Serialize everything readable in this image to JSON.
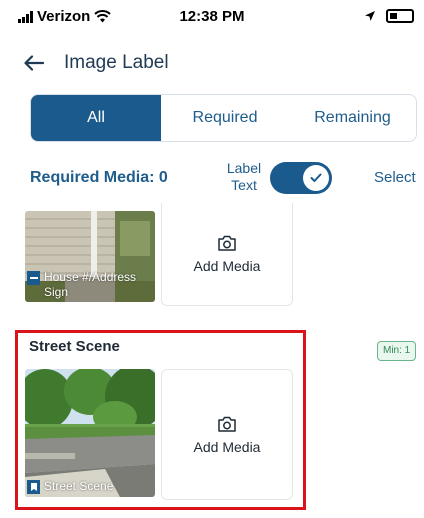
{
  "status_bar": {
    "carrier": "Verizon",
    "time": "12:38 PM"
  },
  "header": {
    "title": "Image Label"
  },
  "tabs": [
    {
      "label": "All",
      "active": true
    },
    {
      "label": "Required",
      "active": false
    },
    {
      "label": "Remaining",
      "active": false
    }
  ],
  "required_row": {
    "label": "Required Media: 0",
    "label_text_line1": "Label",
    "label_text_line2": "Text",
    "toggle_on": true,
    "select": "Select"
  },
  "sections": [
    {
      "thumb_label_line1": "House #/Address",
      "thumb_label_line2": "Sign",
      "add_media": "Add Media"
    },
    {
      "title": "Street Scene",
      "min_badge": "Min: 1",
      "thumb_label": "Street Scene",
      "add_media": "Add Media"
    }
  ],
  "colors": {
    "primary": "#1b5a8c",
    "highlight": "#d9141a",
    "badge_green": "#2f8a58"
  }
}
